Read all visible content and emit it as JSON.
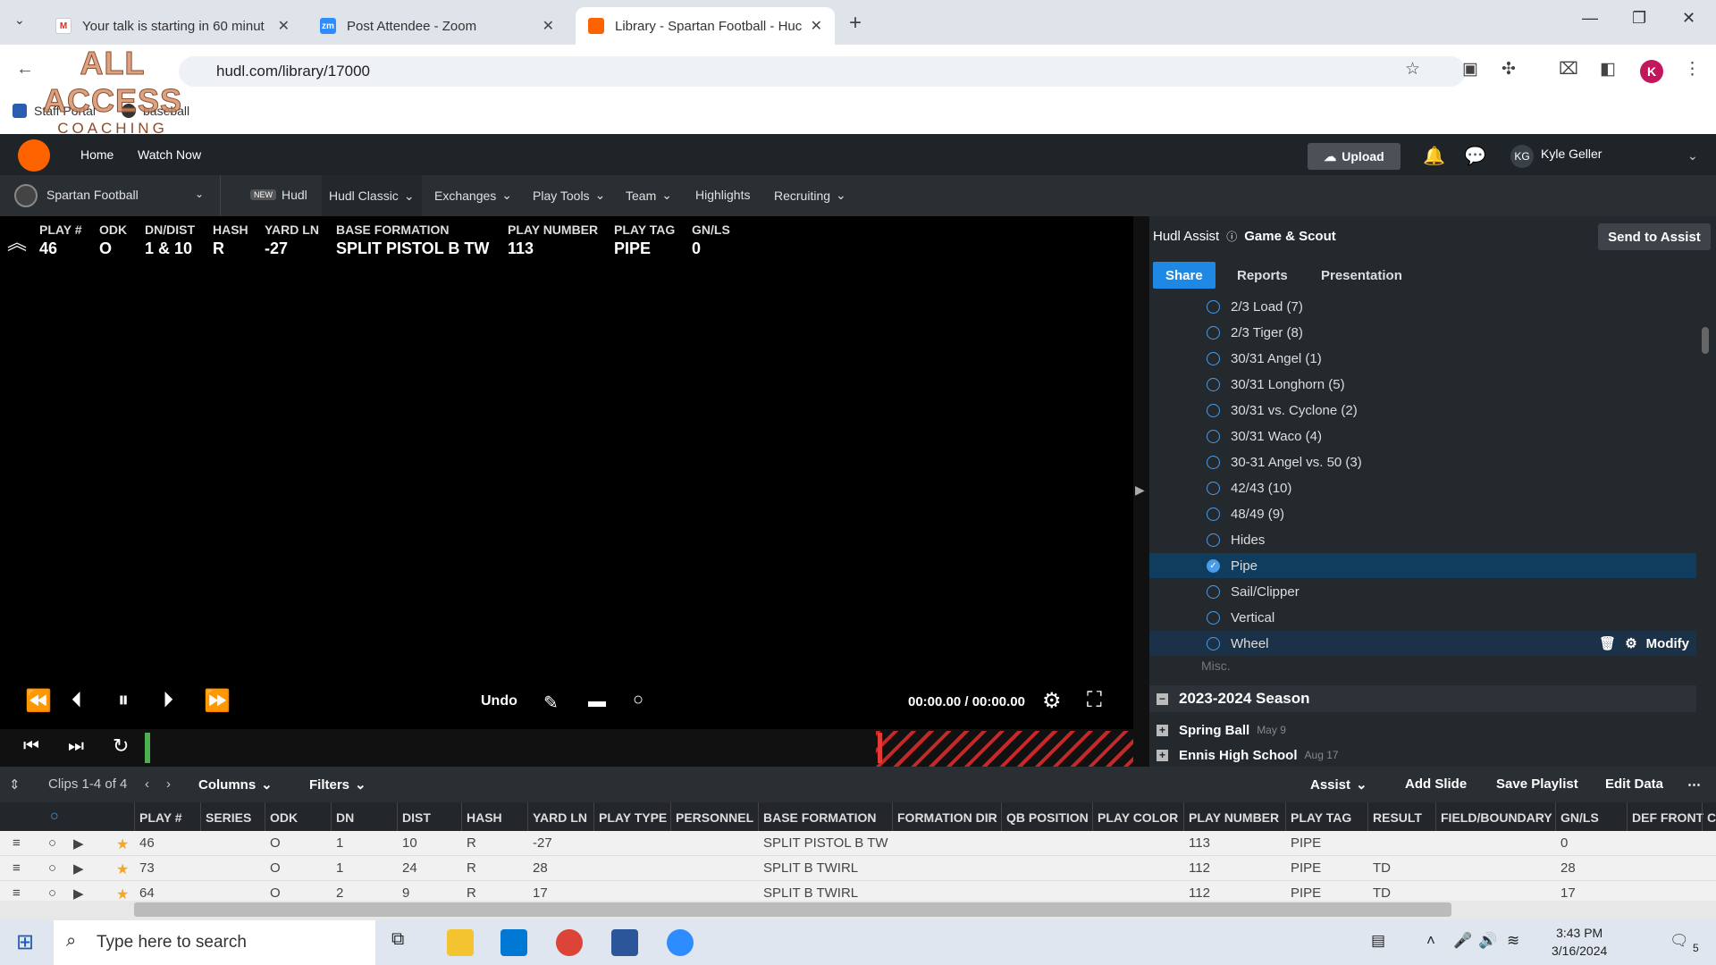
{
  "browser": {
    "tabs": [
      {
        "title": "Your talk is starting in 60 minut",
        "icon": "gmail-icon"
      },
      {
        "title": "Post Attendee - Zoom",
        "icon": "zoom-icon"
      },
      {
        "title": "Library - Spartan Football - Huc",
        "icon": "hudl-icon"
      }
    ],
    "url": "hudl.com/library/17000",
    "bookmarks": [
      "Staff Portal",
      "baseball"
    ],
    "profile_initial": "K",
    "watermark_line1": "ALL ACCESS",
    "watermark_line2": "COACHING"
  },
  "hudl": {
    "nav": [
      "Home",
      "Watch Now"
    ],
    "upload_label": "Upload",
    "user_initials": "KG",
    "user_name": "Kyle Geller",
    "team": "Spartan Football",
    "subnav": {
      "new_badge": "NEW",
      "items": [
        "Hudl",
        "Hudl Classic",
        "Exchanges",
        "Play Tools",
        "Team",
        "Highlights",
        "Recruiting"
      ]
    }
  },
  "play_info": [
    {
      "label": "PLAY #",
      "value": "46"
    },
    {
      "label": "ODK",
      "value": "O"
    },
    {
      "label": "DN/DIST",
      "value": "1 & 10"
    },
    {
      "label": "HASH",
      "value": "R"
    },
    {
      "label": "YARD LN",
      "value": "-27"
    },
    {
      "label": "BASE FORMATION",
      "value": "SPLIT PISTOL B TW"
    },
    {
      "label": "PLAY NUMBER",
      "value": "113"
    },
    {
      "label": "PLAY TAG",
      "value": "PIPE"
    },
    {
      "label": "GN/LS",
      "value": "0"
    }
  ],
  "player": {
    "undo_label": "Undo",
    "time": "00:00.00 / 00:00.00"
  },
  "assist_panel": {
    "title": "Hudl Assist",
    "subtitle": "Game & Scout",
    "send_label": "Send to Assist",
    "tabs": [
      "Share",
      "Reports",
      "Presentation"
    ],
    "tags": [
      {
        "label": "2/3 Load (7)",
        "state": "normal"
      },
      {
        "label": "2/3 Tiger (8)",
        "state": "normal"
      },
      {
        "label": "30/31 Angel (1)",
        "state": "normal"
      },
      {
        "label": "30/31 Longhorn (5)",
        "state": "normal"
      },
      {
        "label": "30/31 vs. Cyclone (2)",
        "state": "normal"
      },
      {
        "label": "30/31 Waco (4)",
        "state": "normal"
      },
      {
        "label": "30-31 Angel vs. 50 (3)",
        "state": "normal"
      },
      {
        "label": "42/43 (10)",
        "state": "normal"
      },
      {
        "label": "48/49 (9)",
        "state": "normal"
      },
      {
        "label": "Hides",
        "state": "normal"
      },
      {
        "label": "Pipe",
        "state": "selected"
      },
      {
        "label": "Sail/Clipper",
        "state": "normal"
      },
      {
        "label": "Vertical",
        "state": "normal"
      },
      {
        "label": "Wheel",
        "state": "hover"
      }
    ],
    "modify_label": "Modify",
    "misc_label": "Misc.",
    "season": "2023-2024 Season",
    "season_items": [
      {
        "label": "Spring Ball",
        "date": "May 9"
      },
      {
        "label": "Ennis High School",
        "date": "Aug 17"
      }
    ]
  },
  "table": {
    "toolbar": {
      "clips": "Clips 1-4 of 4",
      "columns": "Columns",
      "filters": "Filters",
      "assist": "Assist",
      "add_slide": "Add Slide",
      "save_playlist": "Save Playlist",
      "edit_data": "Edit Data"
    },
    "columns": [
      "PLAY #",
      "SERIES",
      "ODK",
      "DN",
      "DIST",
      "HASH",
      "YARD LN",
      "PLAY TYPE",
      "PERSONNEL",
      "BASE FORMATION",
      "FORMATION DIR",
      "QB POSITION",
      "PLAY COLOR",
      "PLAY NUMBER",
      "PLAY TAG",
      "RESULT",
      "FIELD/BOUNDARY",
      "GN/LS",
      "DEF FRONT",
      "C"
    ],
    "rows": [
      {
        "play": "46",
        "odk": "O",
        "dn": "1",
        "dist": "10",
        "hash": "R",
        "yard": "-27",
        "formation": "SPLIT PISTOL B TW",
        "number": "113",
        "tag": "PIPE",
        "result": "",
        "gnls": "0"
      },
      {
        "play": "73",
        "odk": "O",
        "dn": "1",
        "dist": "24",
        "hash": "R",
        "yard": "28",
        "formation": "SPLIT B TWIRL",
        "number": "112",
        "tag": "PIPE",
        "result": "TD",
        "gnls": "28"
      },
      {
        "play": "64",
        "odk": "O",
        "dn": "2",
        "dist": "9",
        "hash": "R",
        "yard": "17",
        "formation": "SPLIT B TWIRL",
        "number": "112",
        "tag": "PIPE",
        "result": "TD",
        "gnls": "17"
      }
    ]
  },
  "taskbar": {
    "search_placeholder": "Type here to search",
    "time": "3:43 PM",
    "date": "3/16/2024",
    "notif_count": "5"
  }
}
